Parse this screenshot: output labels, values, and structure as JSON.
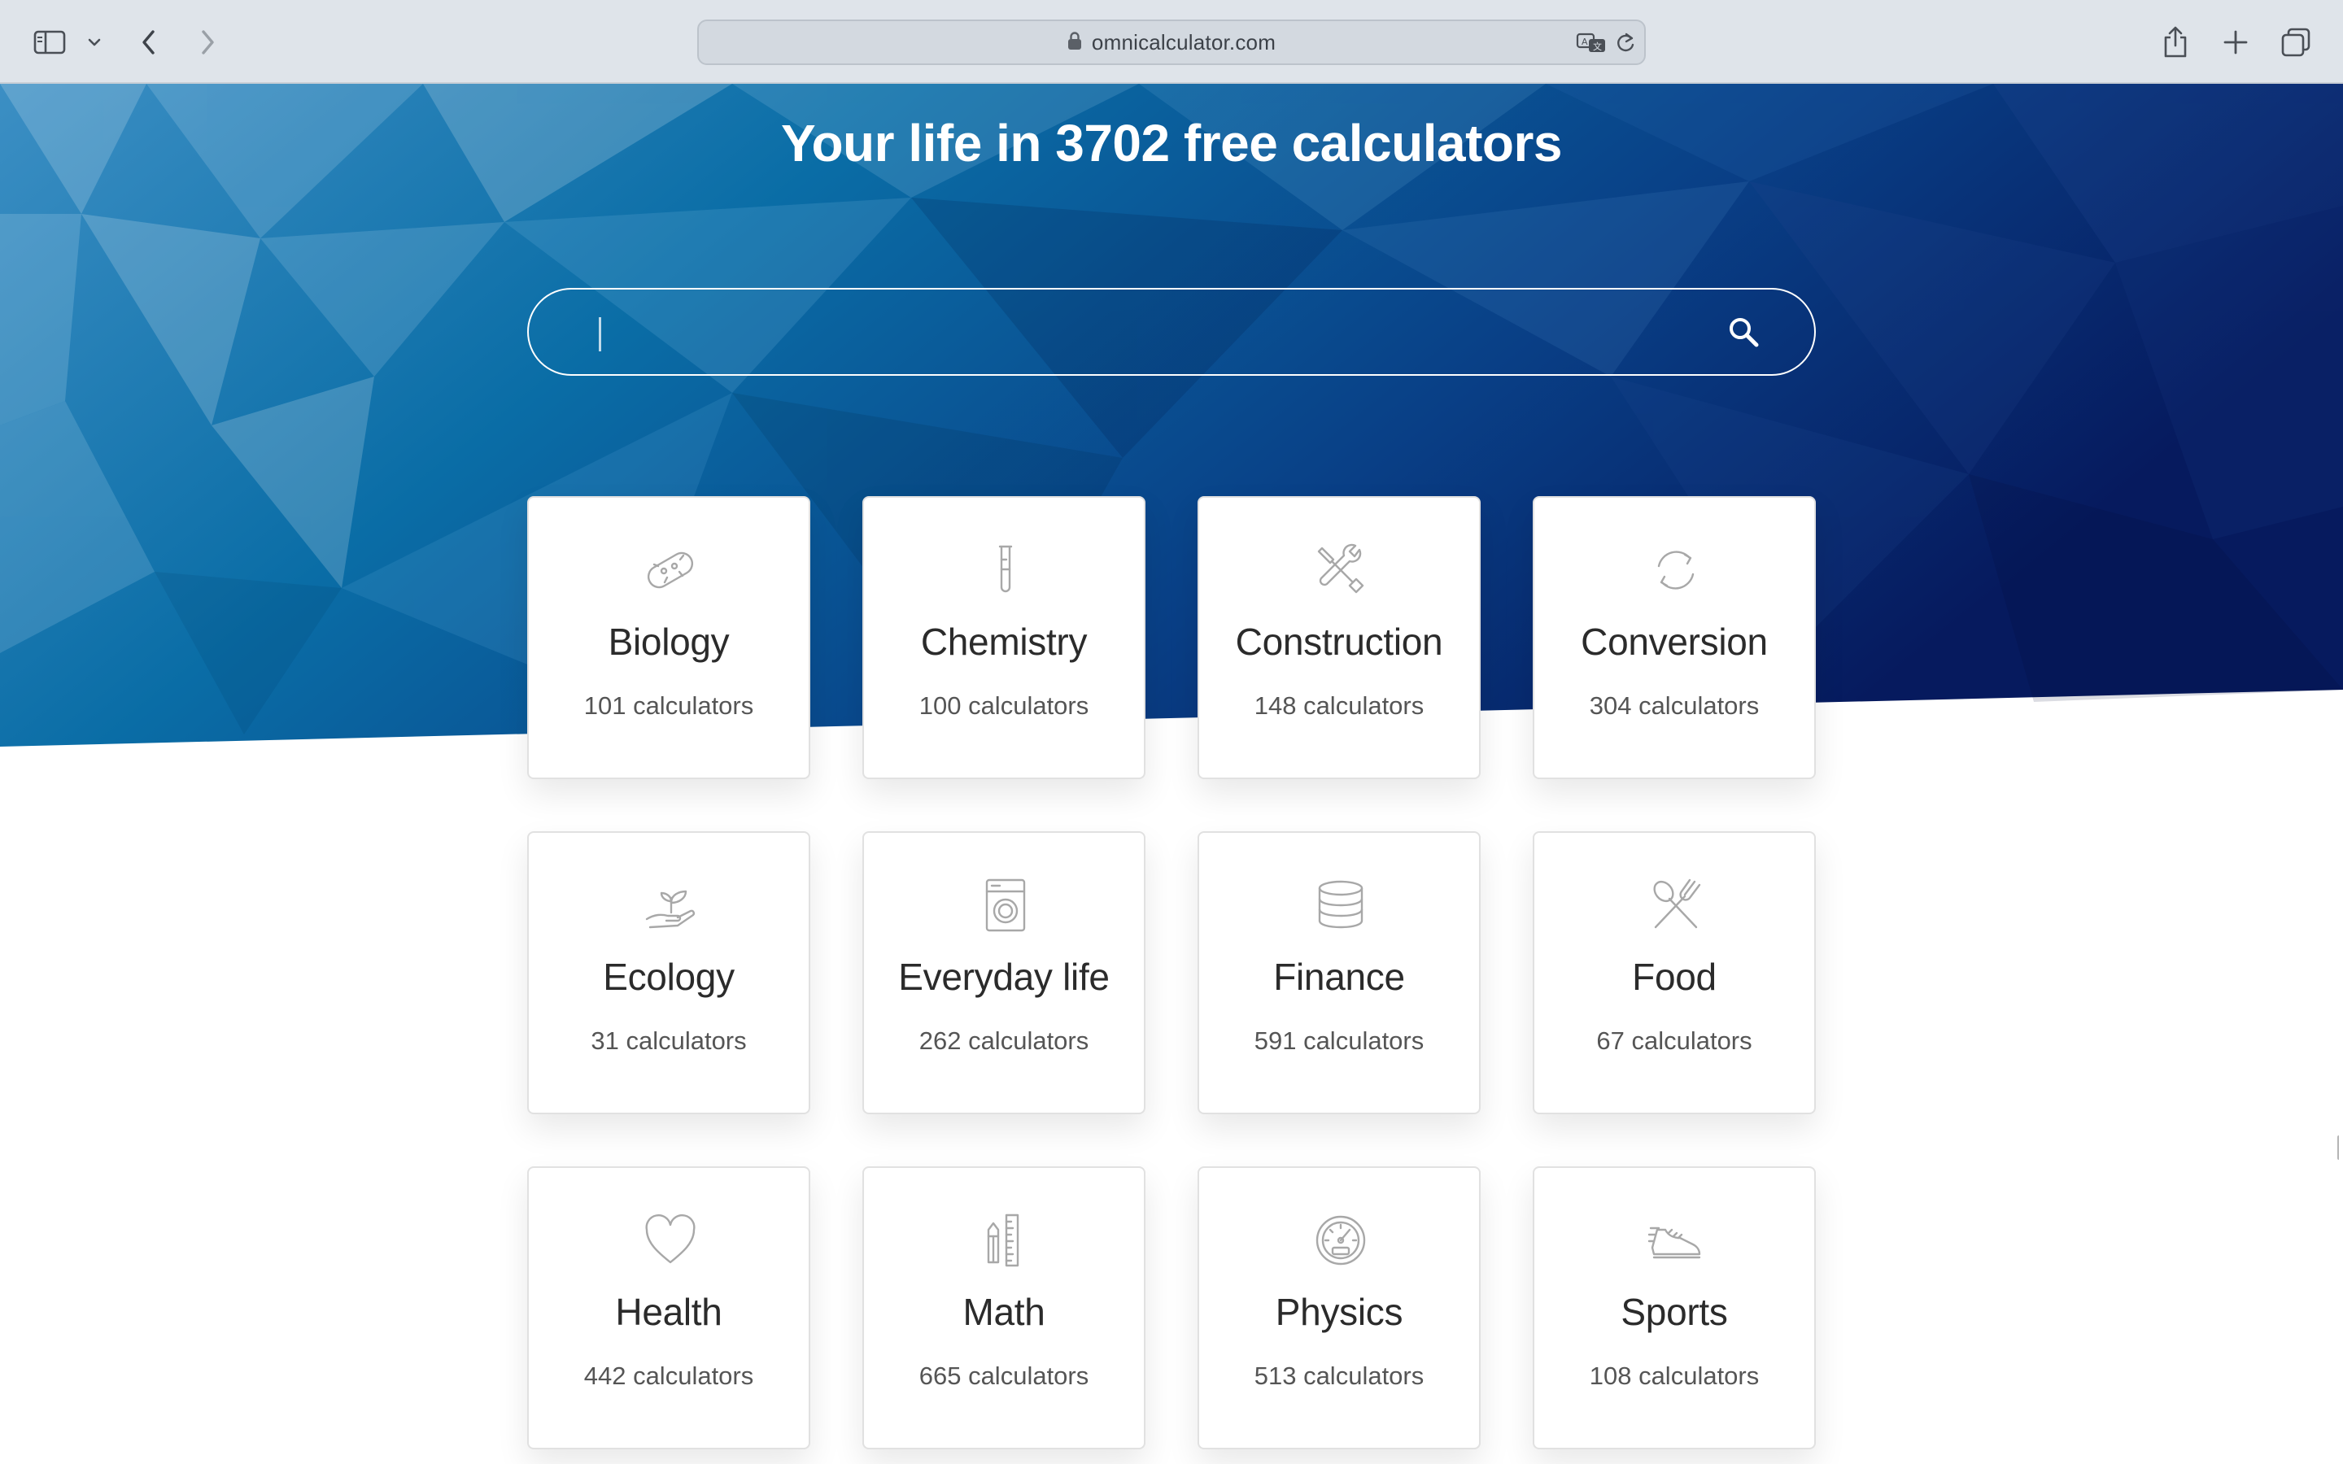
{
  "browser": {
    "url": "omnicalculator.com",
    "icons": {
      "sidebar": "sidebar-icon",
      "sidebar_menu": "chevron-down-icon",
      "back": "back-icon",
      "forward": "forward-icon",
      "lock": "lock-icon",
      "translate": "translate-icon",
      "reload": "reload-icon",
      "share": "share-icon",
      "new_tab": "plus-icon",
      "tabs": "tab-overview-icon"
    }
  },
  "hero": {
    "title": "Your life in 3702 free calculators",
    "search_placeholder": "",
    "search_icon": "search-icon",
    "colors": {
      "dark": "#061a5e",
      "mid": "#0a5c97",
      "light": "#3c8fc4"
    }
  },
  "categories": [
    {
      "name": "Biology",
      "count": "101 calculators",
      "icon": "bacteria-icon"
    },
    {
      "name": "Chemistry",
      "count": "100 calculators",
      "icon": "test-tube-icon"
    },
    {
      "name": "Construction",
      "count": "148 calculators",
      "icon": "tools-icon"
    },
    {
      "name": "Conversion",
      "count": "304 calculators",
      "icon": "convert-arrows-icon"
    },
    {
      "name": "Ecology",
      "count": "31 calculators",
      "icon": "seedling-hand-icon"
    },
    {
      "name": "Everyday life",
      "count": "262 calculators",
      "icon": "washing-machine-icon"
    },
    {
      "name": "Finance",
      "count": "591 calculators",
      "icon": "coins-stack-icon"
    },
    {
      "name": "Food",
      "count": "67 calculators",
      "icon": "fork-spoon-icon"
    },
    {
      "name": "Health",
      "count": "442 calculators",
      "icon": "heart-icon"
    },
    {
      "name": "Math",
      "count": "665 calculators",
      "icon": "pencil-ruler-icon"
    },
    {
      "name": "Physics",
      "count": "513 calculators",
      "icon": "gauge-icon"
    },
    {
      "name": "Sports",
      "count": "108 calculators",
      "icon": "sneaker-icon"
    }
  ]
}
